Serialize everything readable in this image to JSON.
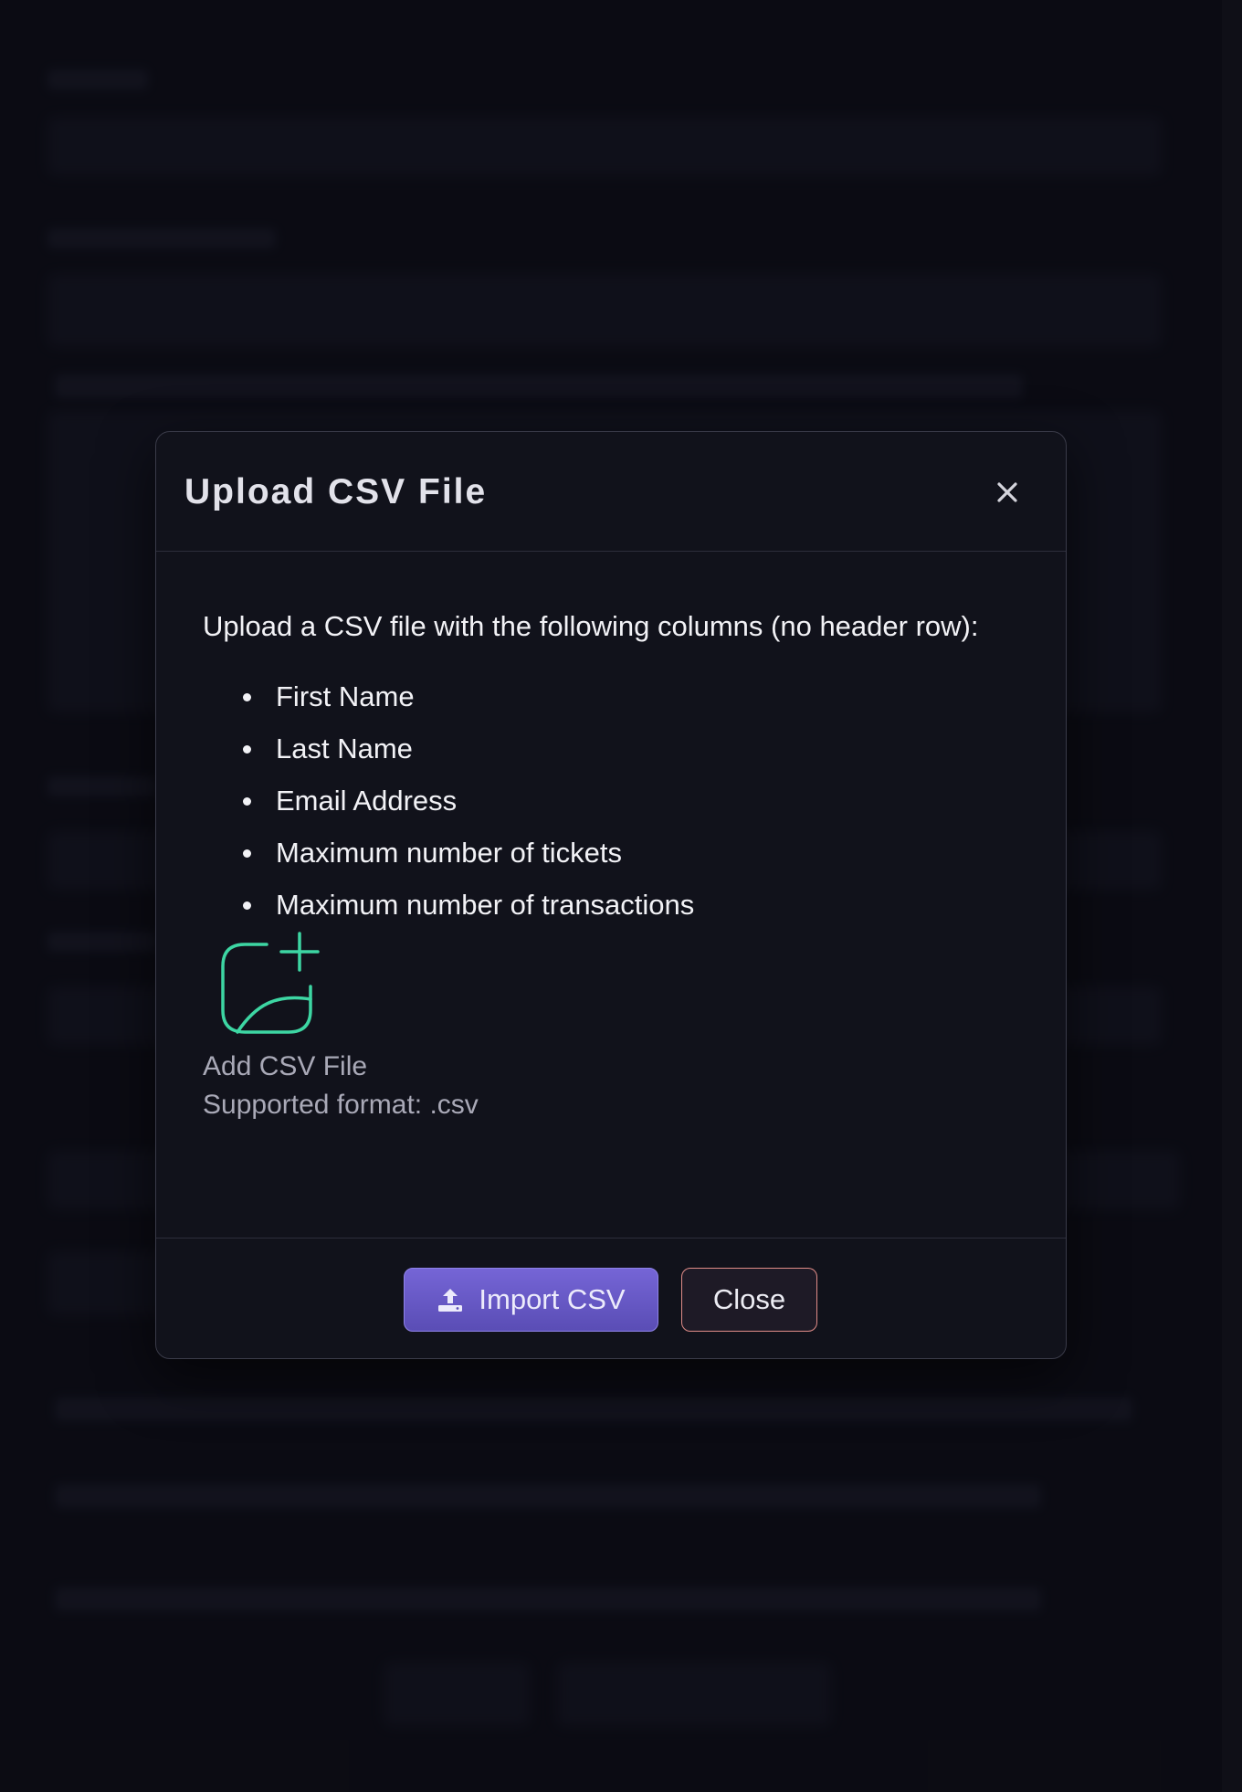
{
  "modal": {
    "title": "Upload CSV File",
    "close_icon": "close-icon",
    "intro": "Upload a CSV file with the following columns (no header row):",
    "columns": [
      "First Name",
      "Last Name",
      "Email Address",
      "Maximum number of tickets",
      "Maximum number of transactions"
    ],
    "file_input": {
      "icon": "add-image-icon",
      "label": "Add CSV File",
      "format": "Supported format: .csv"
    },
    "footer": {
      "import_icon": "upload-icon",
      "import_label": "Import CSV",
      "close_label": "Close"
    }
  },
  "colors": {
    "accent": "#6a5bd0",
    "icon_green": "#3dd6a3",
    "close_border": "#e08c88"
  }
}
